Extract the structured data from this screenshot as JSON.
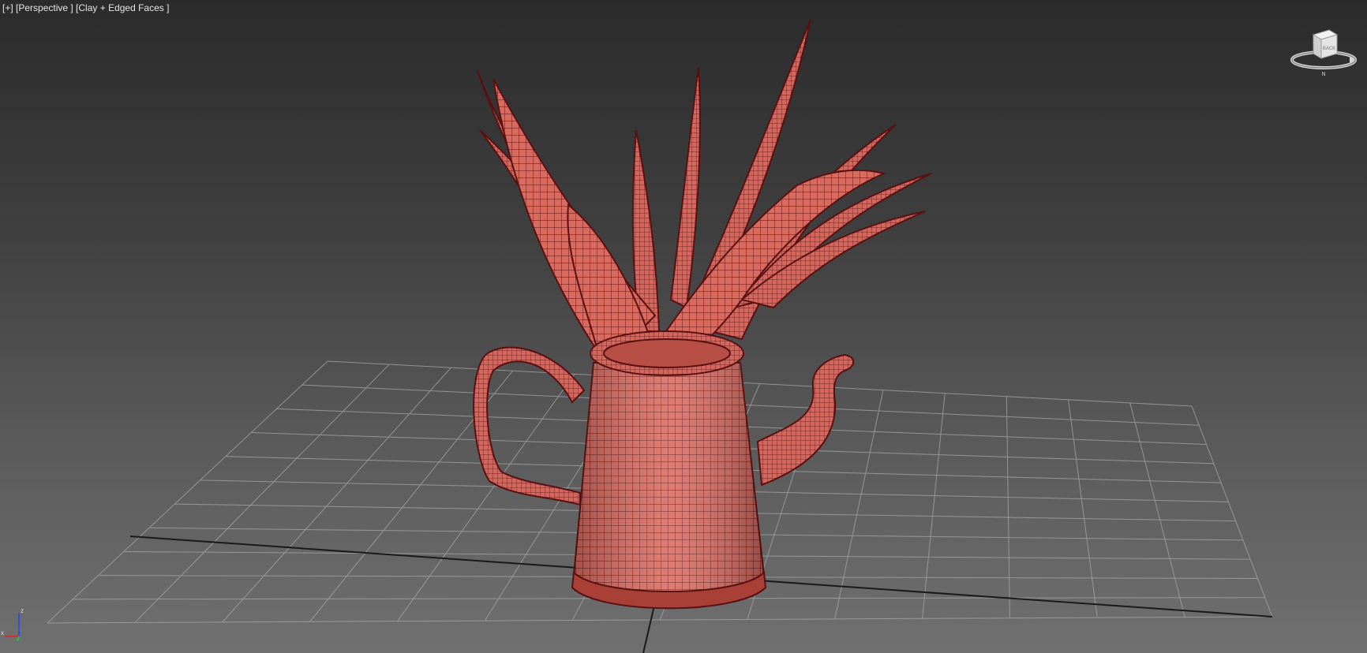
{
  "viewport": {
    "label_segments": [
      "[+]",
      " [Perspective ]",
      " [Clay + Edged Faces ]"
    ],
    "background_top": "#2b2b2b",
    "background_bottom": "#707070"
  },
  "viewcube": {
    "face_label": "BACK",
    "compass_label": "N",
    "icon": "viewcube-icon"
  },
  "axis_tripod": {
    "x_label": "x",
    "z_label": "z",
    "x_color": "#d03030",
    "y_color": "#30c030",
    "z_color": "#3050e0"
  },
  "model": {
    "clay_color": "#d96a60",
    "edge_color": "#5a1010",
    "grid_color": "#a8a8a8"
  }
}
